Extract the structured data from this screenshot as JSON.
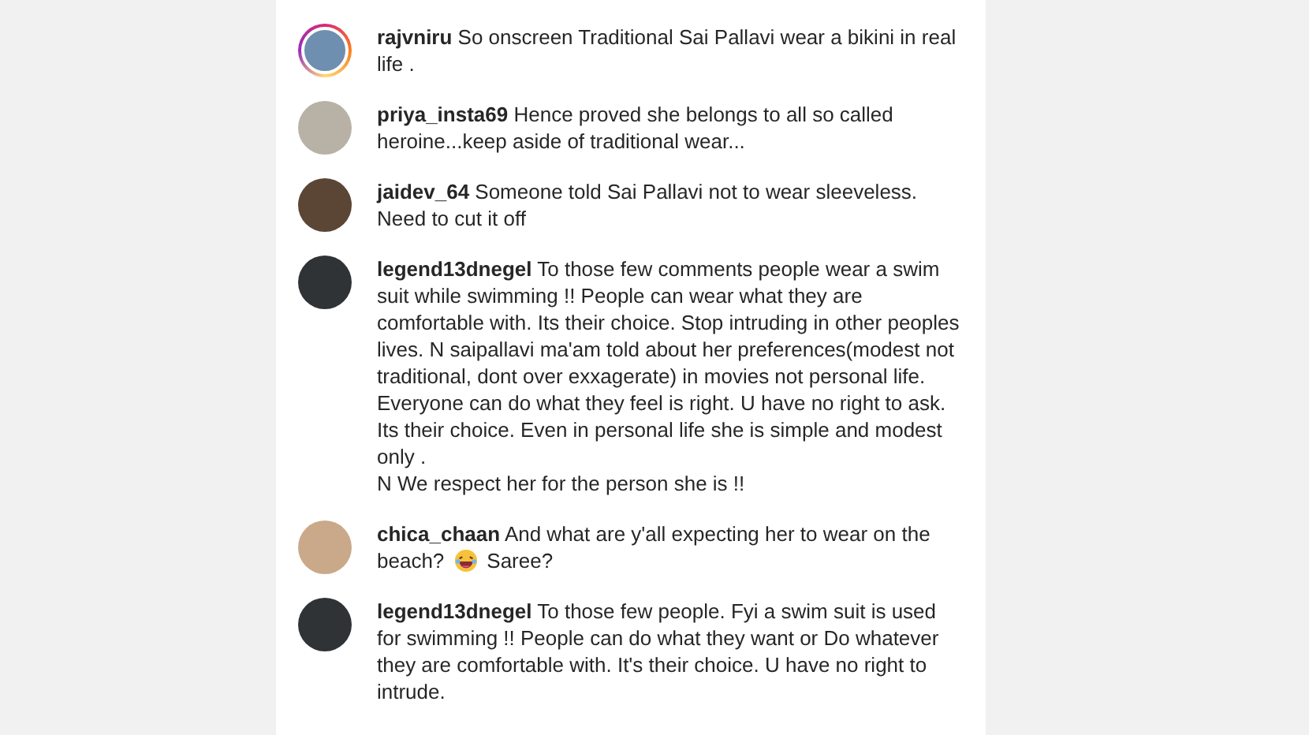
{
  "comments": [
    {
      "username": "rajvniru",
      "story_ring": true,
      "text": "So onscreen Traditional Sai Pallavi wear a bikini in real life ."
    },
    {
      "username": "priya_insta69",
      "story_ring": false,
      "text": "Hence proved she belongs to all so called heroine...keep aside of traditional wear..."
    },
    {
      "username": "jaidev_64",
      "story_ring": false,
      "text": "Someone told Sai Pallavi not to wear sleeveless. Need to cut it off"
    },
    {
      "username": "legend13dnegel",
      "story_ring": false,
      "text": "To those few comments people wear a swim suit while swimming !! People can wear what they are comfortable with. Its their choice. Stop intruding in other peoples lives. N saipallavi ma'am told about her preferences(modest not traditional, dont over exxagerate) in movies not personal life. Everyone can do what they feel is right. U have no right to ask. Its their choice. Even in personal life she is simple and modest only .\nN We respect her for the person she is !!"
    },
    {
      "username": "chica_chaan",
      "story_ring": false,
      "text": "And what are y'all expecting her to wear on the",
      "line_2": {
        "before": "beach?",
        "laughing_emoji": true,
        "after": "Saree?"
      }
    },
    {
      "username": "legend13dnegel",
      "story_ring": false,
      "text": "To those few people. Fyi a swim suit is used for swimming !! People can do what they want or Do whatever they are comfortable with. It's their choice. U have no right to intrude."
    }
  ]
}
